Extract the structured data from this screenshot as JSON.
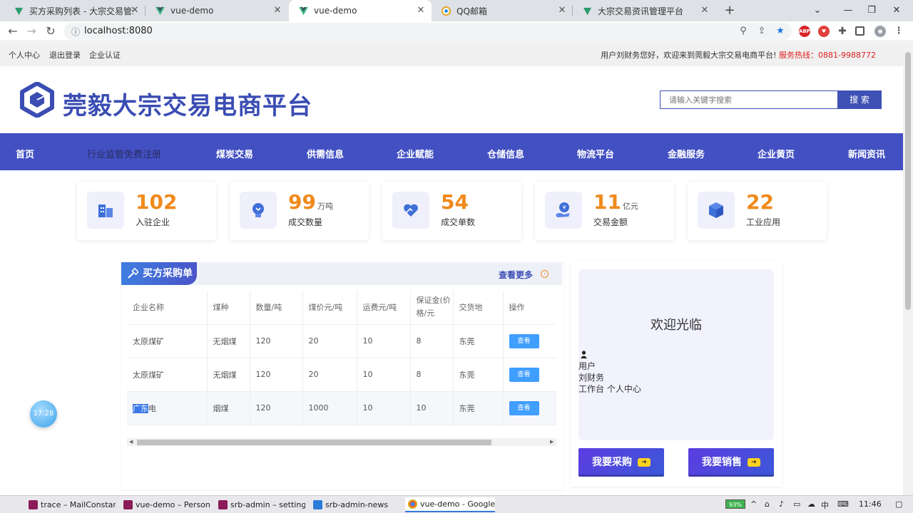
{
  "browser": {
    "tabs": [
      {
        "title": "买方采购列表 - 大宗交易管理平台",
        "active": false
      },
      {
        "title": "vue-demo",
        "active": false
      },
      {
        "title": "vue-demo",
        "active": true
      },
      {
        "title": "QQ邮箱",
        "active": false
      },
      {
        "title": "大宗交易资讯管理平台",
        "active": false
      }
    ],
    "url": "localhost:8080"
  },
  "topbar": {
    "links": [
      "个人中心",
      "退出登录",
      "企业认证"
    ],
    "greeting": "用户刘财务您好，欢迎来到莞毅大宗交易电商平台!",
    "hotline": "服务热线：0881-9988772"
  },
  "header": {
    "site_title": "莞毅大宗交易电商平台",
    "search_placeholder": "请输入关键字搜索",
    "search_button": "搜 索"
  },
  "nav": [
    "首页",
    "行业监管免费注册",
    "煤炭交易",
    "供需信息",
    "企业赋能",
    "仓储信息",
    "物流平台",
    "金融服务",
    "企业黄页",
    "新闻资讯"
  ],
  "stats": [
    {
      "value": "102",
      "unit": "",
      "label": "入驻企业",
      "icon": "building-icon"
    },
    {
      "value": "99",
      "unit": "万吨",
      "label": "成交数量",
      "icon": "lightbulb-icon"
    },
    {
      "value": "54",
      "unit": "",
      "label": "成交单数",
      "icon": "heart-hand-icon"
    },
    {
      "value": "11",
      "unit": "亿元",
      "label": "交易金额",
      "icon": "money-hand-icon"
    },
    {
      "value": "22",
      "unit": "",
      "label": "工业应用",
      "icon": "cube-icon"
    }
  ],
  "purchase": {
    "title": "买方采购单",
    "more": "查看更多",
    "columns": [
      "企业名称",
      "煤种",
      "数量/吨",
      "煤价元/吨",
      "运费元/吨",
      "保证金(价格/元",
      "交货地",
      "操作"
    ],
    "rows": [
      {
        "company": "太原煤矿",
        "coal": "无烟煤",
        "qty": "120",
        "price": "20",
        "freight": "10",
        "deposit": "8",
        "place": "东莞",
        "action": "查看"
      },
      {
        "company": "太原煤矿",
        "coal": "无烟煤",
        "qty": "120",
        "price": "20",
        "freight": "10",
        "deposit": "8",
        "place": "东莞",
        "action": "查看"
      },
      {
        "company_sel": "广东",
        "company_rest": "电",
        "coal": "烟煤",
        "qty": "120",
        "price": "1000",
        "freight": "10",
        "deposit": "10",
        "place": "东莞",
        "action": "查看"
      }
    ]
  },
  "welcome": {
    "title": "欢迎光临",
    "role": "用户",
    "name": "刘财务",
    "links": "工作台 个人中心",
    "buy_button": "我要采购",
    "sell_button": "我要销售"
  },
  "clock_widget": "17:28",
  "taskbar": {
    "items": [
      "trace – MailConstan...",
      "vue-demo – Person...",
      "srb-admin – setting...",
      "srb-admin-news",
      "vue-demo - Google..."
    ],
    "battery": "93%",
    "ime": "中",
    "time": "11:46"
  },
  "colors": {
    "primary": "#4250c2",
    "accent": "#f08a1c",
    "hotline": "#e02020",
    "button": "#409eff"
  }
}
